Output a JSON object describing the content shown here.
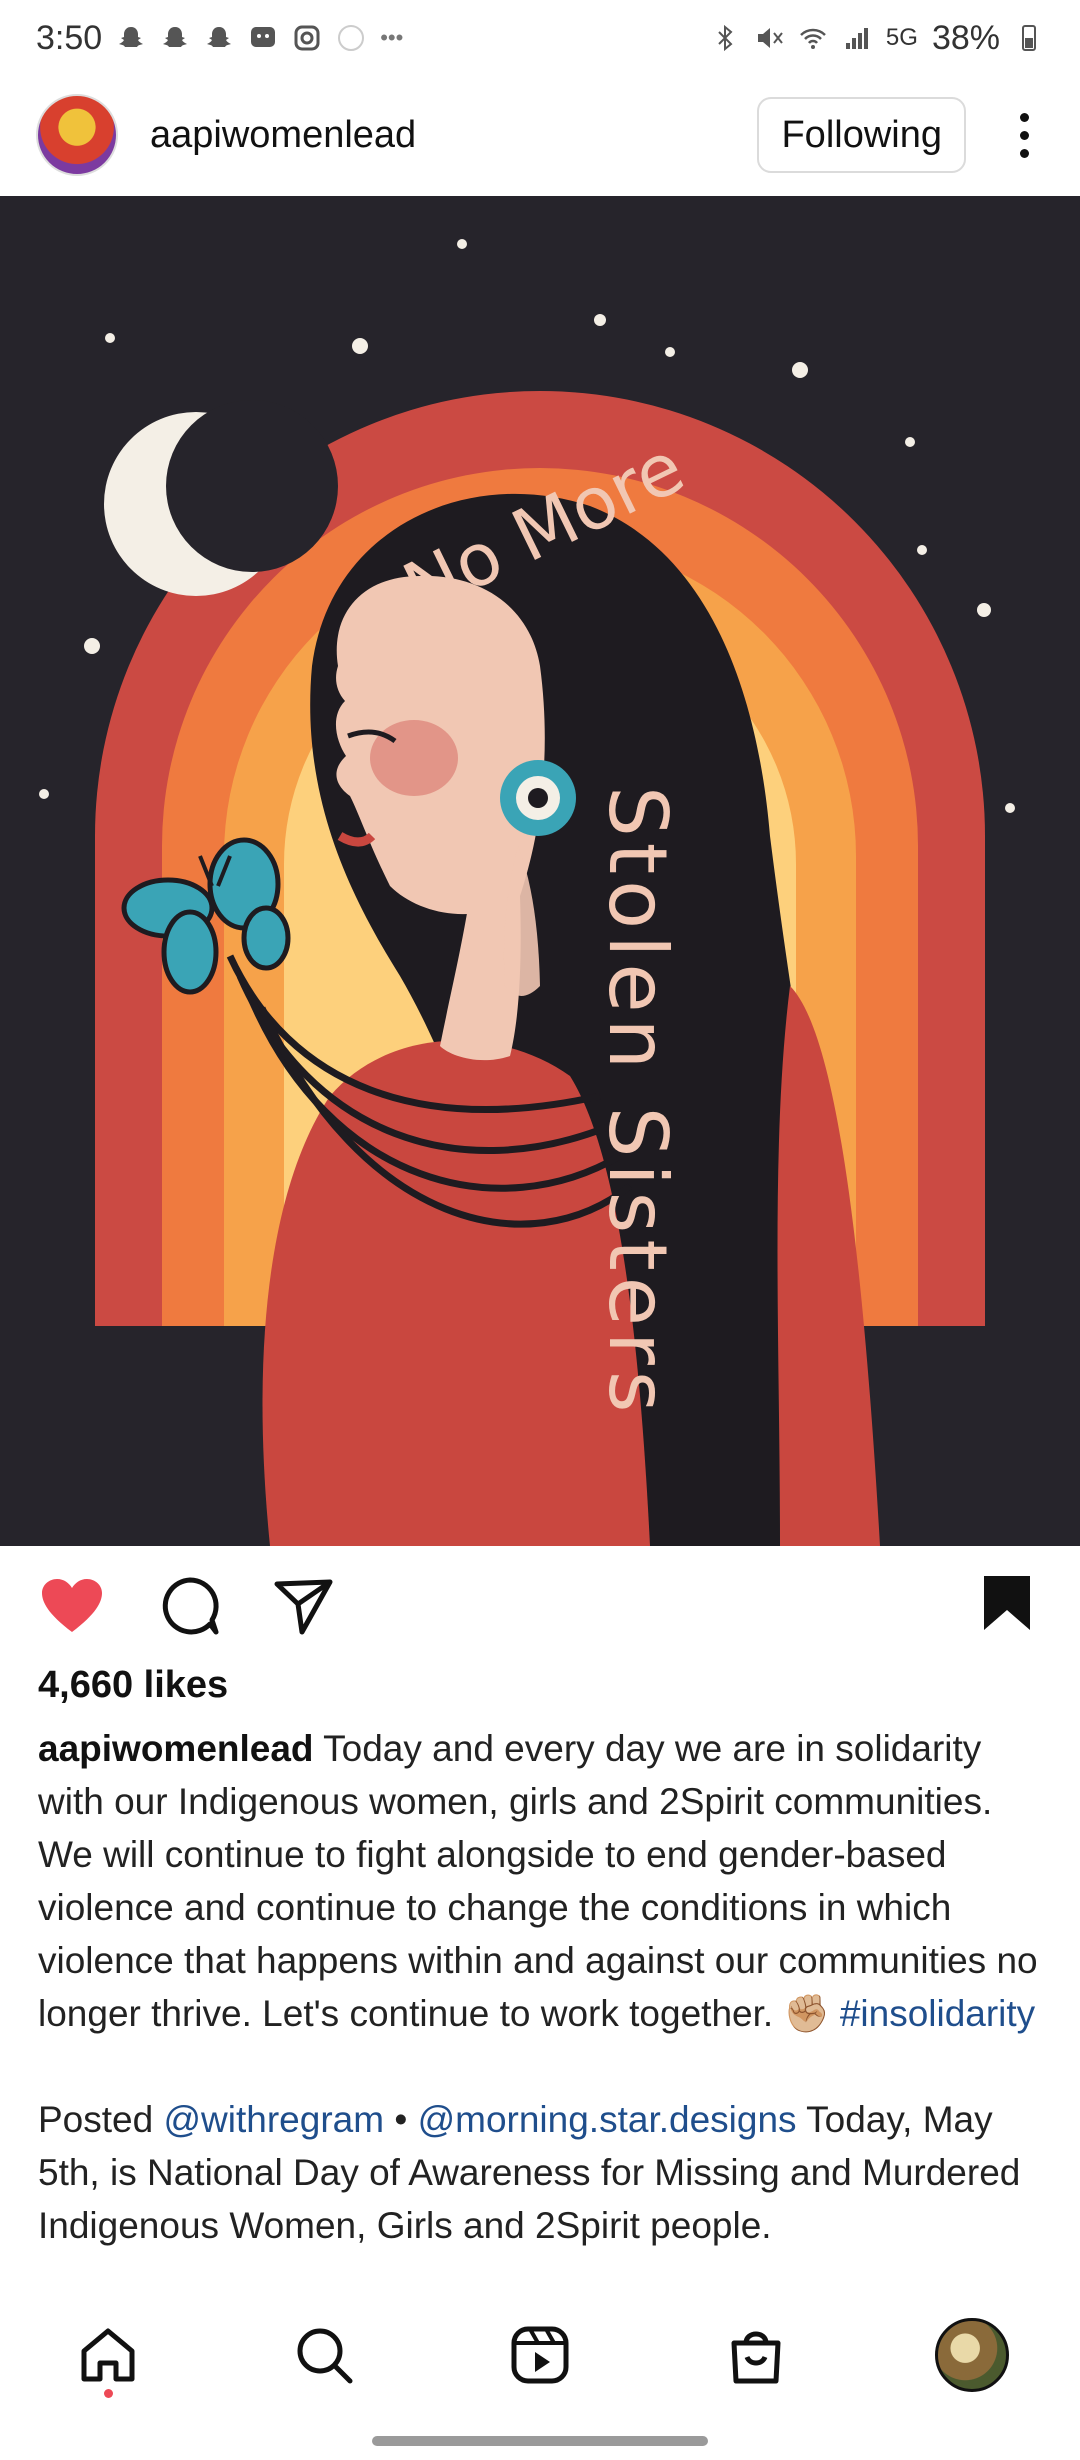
{
  "status_bar": {
    "time": "3:50",
    "battery": "38%",
    "network": "5G"
  },
  "post_header": {
    "username": "aapiwomenlead",
    "follow_label": "Following"
  },
  "artwork": {
    "text_line1": "No More",
    "text_line2": "Stolen Sisters"
  },
  "post": {
    "likes": "4,660 likes",
    "caption_user": "aapiwomenlead",
    "caption_text": "Today and every day we are in solidarity with our Indigenous women, girls and 2Spirit communities. We will continue to fight alongside to end gender-based violence and continue to change the conditions in which violence that happens within and against our communities no longer thrive. Let's continue to work together.",
    "emoji": "✊🏼",
    "hashtag": "#insolidarity",
    "p2_prefix": "Posted",
    "mention1": "@withregram",
    "separator": "•",
    "mention2": "@morning.star.designs",
    "p2_text": "Today, May 5th, is National Day of Awareness for Missing and Murdered Indigenous Women, Girls and 2Spirit people."
  },
  "colors": {
    "heart": "#ed4956",
    "hashtag": "#1f4e8c",
    "art_bg": "#26242b"
  },
  "icons": [
    "heart-icon",
    "comment-icon",
    "share-icon",
    "bookmark-icon",
    "home-icon",
    "search-icon",
    "reels-icon",
    "shop-icon",
    "profile-avatar"
  ]
}
